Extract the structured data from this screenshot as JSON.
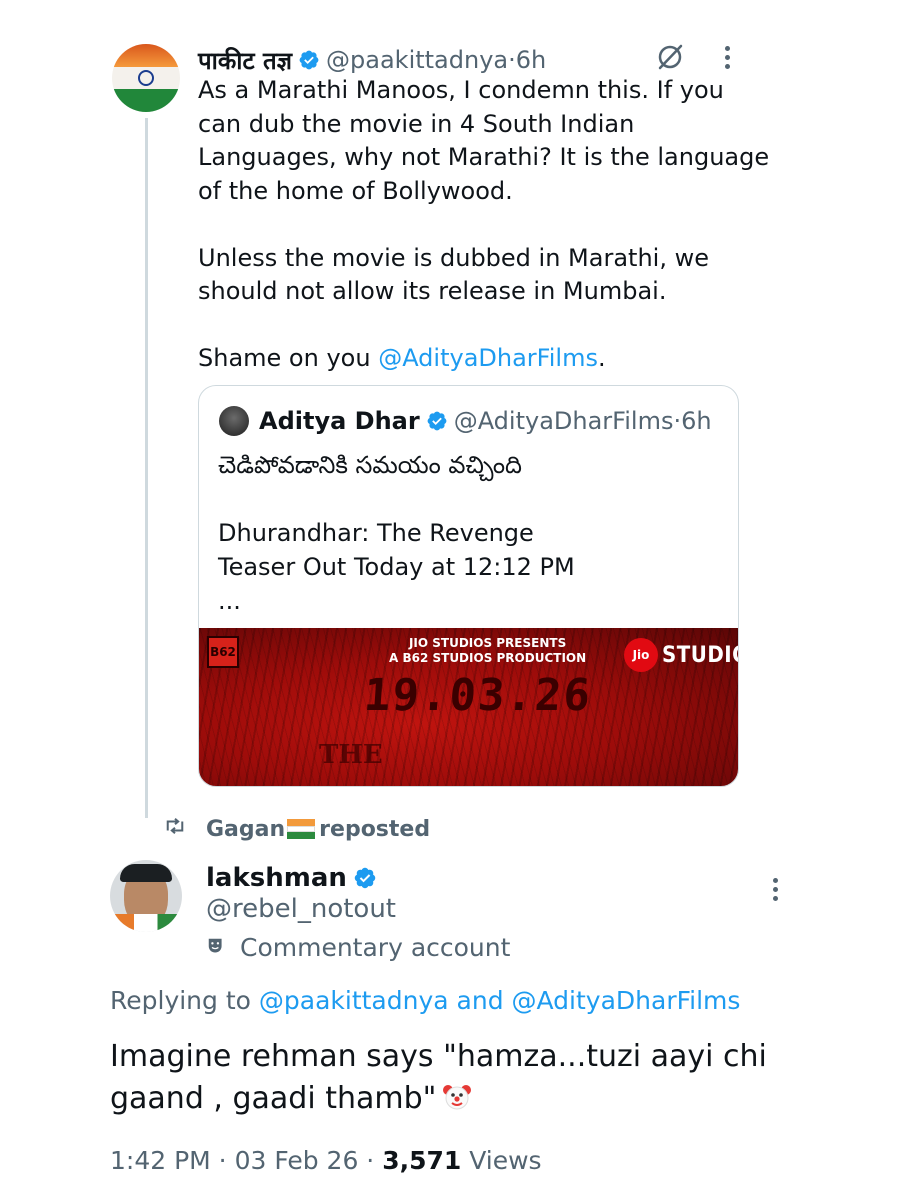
{
  "tweet": {
    "name": "पाकीट तज्ञ",
    "handle": "@paakittadnya",
    "time_sep": " · ",
    "time": "6h",
    "paragraphs": [
      "As a Marathi Manoos, I condemn this. If you\ncan dub the movie in 4 South Indian\nLanguages, why not Marathi? It is the language\nof the home of Bollywood.",
      "Unless the movie is dubbed in Marathi, we\nshould not allow its release in Mumbai."
    ],
    "shame_prefix": "Shame on you ",
    "shame_mention": "@AdityaDharFilms",
    "shame_suffix": "."
  },
  "quote": {
    "name": "Aditya Dhar",
    "handle": "@AdityaDharFilms",
    "time_sep": " · ",
    "time": "6h",
    "line_telugu": "చెడిపోవడానికి సమయం వచ్చింది",
    "line_title": "Dhurandhar: The Revenge\nTeaser Out Today at 12:12 PM",
    "ellipsis": "...",
    "media": {
      "presents_line1": "JIO STUDIOS PRESENTS",
      "presents_line2": "A B62 STUDIOS PRODUCTION",
      "jio_badge": "Jio",
      "studios": "STUDIOS",
      "logo": "B62",
      "date": "19.03.26",
      "partial_text": "THE"
    }
  },
  "repost": {
    "user": "Gagan",
    "label": "reposted"
  },
  "reply": {
    "name": "lakshman",
    "handle": "@rebel_notout",
    "account_label": "Commentary account",
    "replying_prefix": "Replying to ",
    "replying_user1": "@paakittadnya",
    "replying_and": " and ",
    "replying_user2": "@AdityaDharFilms",
    "text": "Imagine rehman says \"hamza...tuzi aayi chi gaand , gaadi thamb\"",
    "time": "1:42 PM",
    "sep1": " · ",
    "date": "03 Feb 26",
    "sep2": " · ",
    "views_count": "3,571",
    "views_label": " Views"
  },
  "icons": {
    "verified": "verified-badge-icon",
    "grok": "grok-icon",
    "more": "more-vertical-icon",
    "repost": "repost-icon",
    "commentary": "theater-mask-icon",
    "clown": "clown-face-emoji",
    "flag": "india-flag-emoji"
  },
  "colors": {
    "link": "#1d9bf0",
    "secondary": "#536471",
    "text": "#0f1419",
    "border": "#cfd9de",
    "verified": "#1d9bf0"
  }
}
